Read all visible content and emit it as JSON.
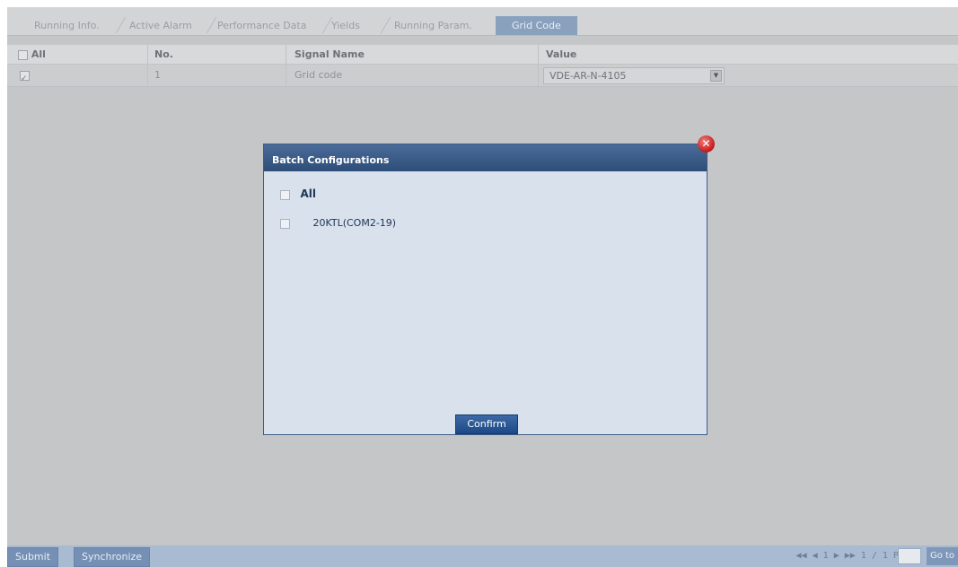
{
  "tabs": [
    {
      "label": "Running Info."
    },
    {
      "label": "Active Alarm"
    },
    {
      "label": "Performance Data"
    },
    {
      "label": "Yields"
    },
    {
      "label": "Running Param."
    },
    {
      "label": "Grid Code"
    }
  ],
  "table": {
    "headers": {
      "all": "All",
      "no": "No.",
      "signal": "Signal Name",
      "value": "Value"
    },
    "rows": [
      {
        "no": "1",
        "signal": "Grid code",
        "value": "VDE-AR-N-4105",
        "checked": true
      }
    ]
  },
  "modal": {
    "title": "Batch Configurations",
    "all_label": "All",
    "device_label": "20KTL(COM2-19)",
    "confirm_label": "Confirm"
  },
  "footer": {
    "submit_label": "Submit",
    "sync_label": "Synchronize",
    "pager_text": "◀◀ ◀ 1 ▶ ▶▶  1 / 1  Page",
    "goto_label": "Go to"
  },
  "colors": {
    "accent": "#2e4e79",
    "close": "#c41818"
  }
}
